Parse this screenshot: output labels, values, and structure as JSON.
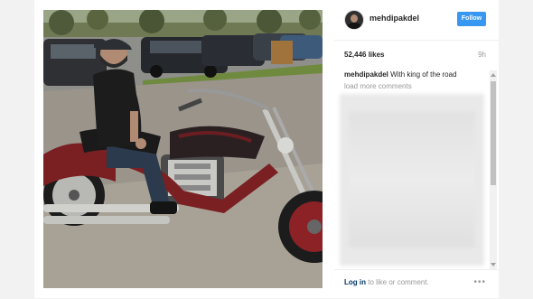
{
  "post": {
    "username": "mehdipakdel",
    "follow_label": "Follow",
    "likes": "52,446 likes",
    "time": "9h",
    "caption_user": "mehdipakdel",
    "caption_text": "With king of the road",
    "load_more": "load more comments",
    "login_link": "Log in",
    "login_rest": "to like or comment.",
    "more_icon": "ellipsis-icon",
    "photo_icon": "photo-man-on-motorcycle"
  },
  "colors": {
    "follow_button": "#3897f0",
    "link": "#003569",
    "muted": "#999999"
  }
}
